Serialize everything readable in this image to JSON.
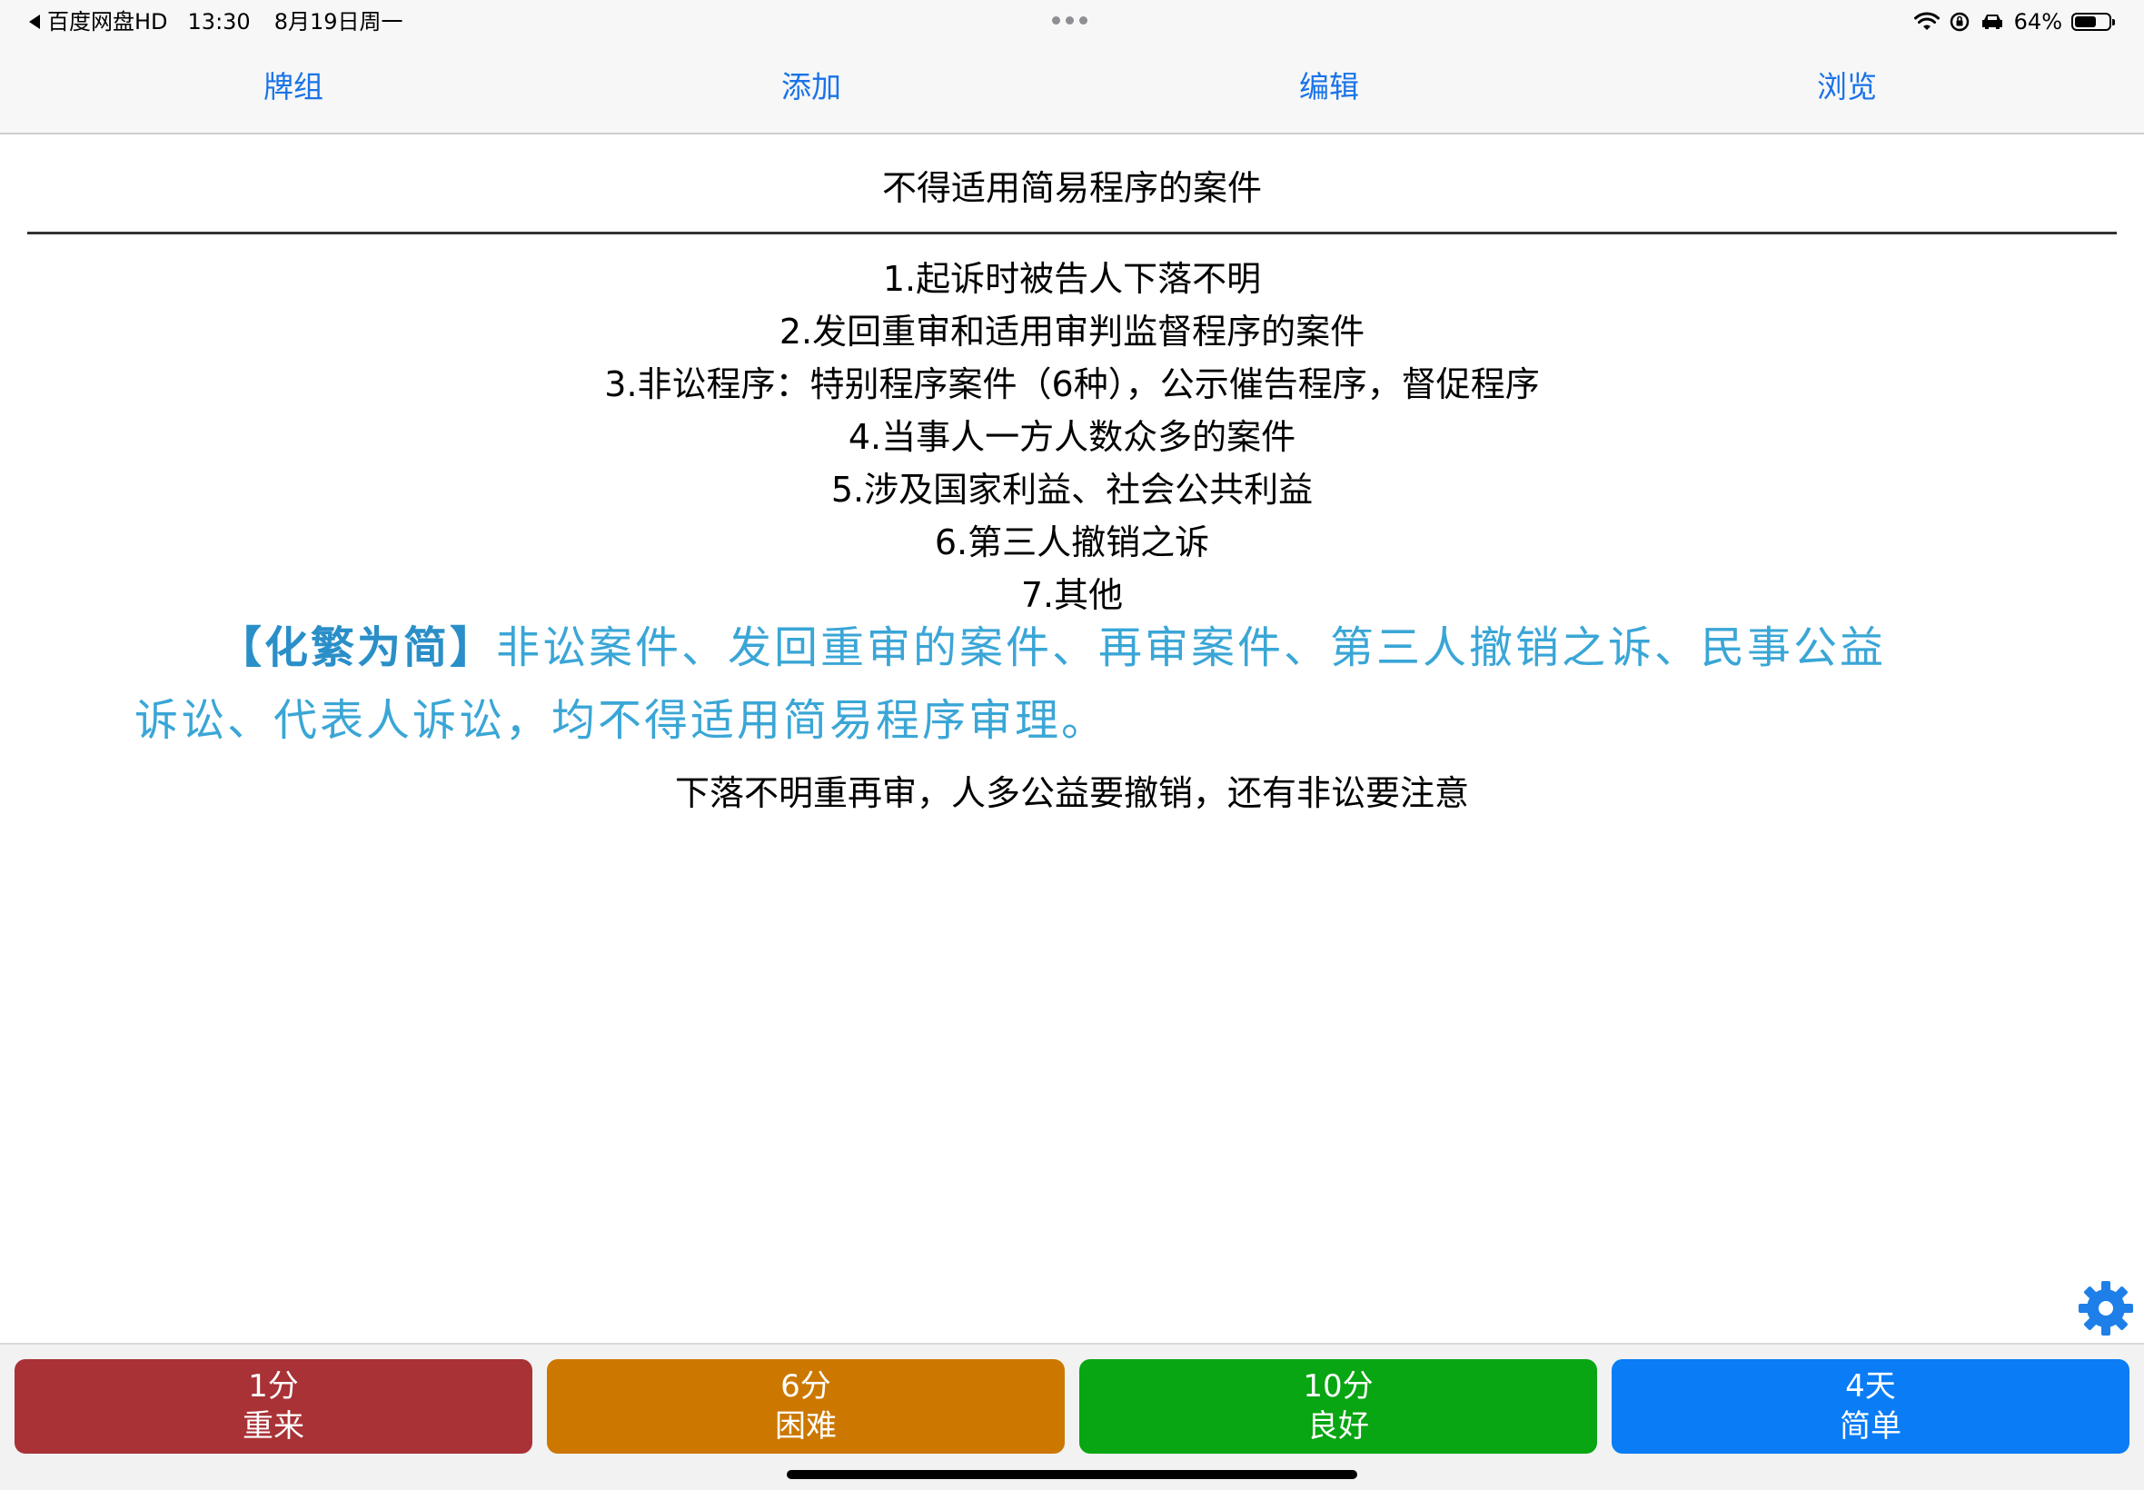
{
  "status_bar": {
    "back_app": "百度网盘HD",
    "time": "13:30",
    "date": "8月19日周一",
    "battery": "64%",
    "battery_level": 0.64
  },
  "nav": {
    "decks": "牌组",
    "add": "添加",
    "edit": "编辑",
    "browse": "浏览"
  },
  "card": {
    "front": "不得适用简易程序的案件",
    "answers": [
      "1.起诉时被告人下落不明",
      "2.发回重审和适用审判监督程序的案件",
      "3.非讼程序：特别程序案件（6种），公示催告程序，督促程序",
      "4.当事人一方人数众多的案件",
      "5.涉及国家利益、社会公共利益",
      "6.第三人撤销之诉",
      "7.其他"
    ],
    "mnemonic_tag": "【化繁为简】",
    "mnemonic_line1": "非讼案件、发回重审的案件、再审案件、第三人撤销之诉、民事公益",
    "mnemonic_line2": "诉讼、代表人诉讼，均不得适用简易程序审理。",
    "summary": "下落不明重再审，人多公益要撤销，还有非讼要注意"
  },
  "buttons": {
    "again": {
      "interval": "1分",
      "label": "重来",
      "color": "#a83236"
    },
    "hard": {
      "interval": "6分",
      "label": "困难",
      "color": "#cc7800"
    },
    "good": {
      "interval": "10分",
      "label": "良好",
      "color": "#08a612"
    },
    "easy": {
      "interval": "4天",
      "label": "简单",
      "color": "#0a7cf6"
    }
  },
  "colors": {
    "nav_link": "#1a73e8",
    "mnemonic_text": "#3aa6d6",
    "gear": "#1e7fe8"
  },
  "icons": {
    "back": "back-triangle-icon",
    "wifi": "wifi-icon",
    "orientation_lock": "orientation-lock-icon",
    "car": "car-icon",
    "battery": "battery-icon",
    "settings": "gear-icon"
  }
}
